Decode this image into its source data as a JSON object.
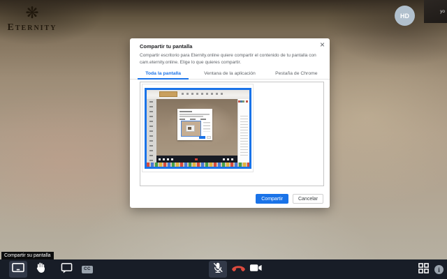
{
  "app": {
    "brand": "Eternity",
    "emblem": "❋",
    "hd_badge": "HD",
    "self_view_label": "yo"
  },
  "dialog": {
    "title": "Compartir tu pantalla",
    "description": "Compartir escritorio para Eternity.online quiere compartir el contenido de tu pantalla con cam.eternity.online. Elige lo que quieres compartir.",
    "close_label": "×",
    "tabs": [
      {
        "label": "Toda la pantalla",
        "active": true
      },
      {
        "label": "Ventana de la aplicación",
        "active": false
      },
      {
        "label": "Pestaña de Chrome",
        "active": false
      }
    ],
    "buttons": {
      "share": "Compartir",
      "cancel": "Cancelar"
    }
  },
  "toolbar": {
    "tooltip": "Compartir su pantalla",
    "cc_label": "CC",
    "info_label": "i",
    "icons_left": [
      "share-screen",
      "raise-hand",
      "chat",
      "closed-captions"
    ],
    "icons_center": [
      "microphone-muted",
      "hang-up",
      "camera"
    ],
    "icons_right": [
      "apps-grid",
      "info"
    ]
  },
  "colors": {
    "accent_blue": "#1a73e8",
    "hangup_red": "#dd4b3e",
    "toolbar_bg": "#181d27",
    "tab_inactive_text": "#5f6368"
  }
}
